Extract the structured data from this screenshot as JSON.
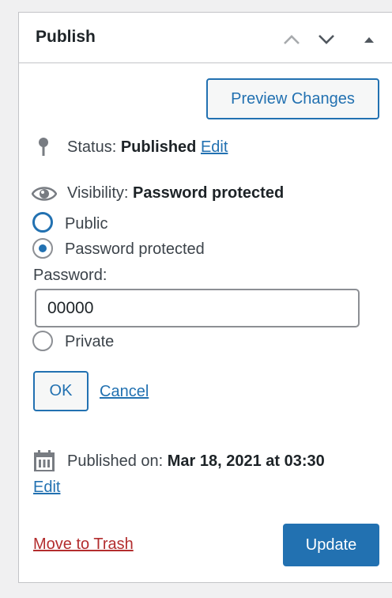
{
  "panel": {
    "title": "Publish",
    "move_up_icon": "chevron-up-icon",
    "move_down_icon": "chevron-down-icon",
    "toggle_icon": "triangle-up-icon"
  },
  "preview_button": "Preview Changes",
  "status": {
    "label": "Status:",
    "value": "Published",
    "edit_link": "Edit",
    "icon": "pin-icon"
  },
  "visibility": {
    "label": "Visibility:",
    "value": "Password protected",
    "icon": "eye-icon",
    "options": [
      {
        "label": "Public",
        "checked": false,
        "focused": true
      },
      {
        "label": "Password protected",
        "checked": true,
        "focused": false
      },
      {
        "label": "Private",
        "checked": false,
        "focused": false
      }
    ],
    "password_label": "Password:",
    "password_value": "00000",
    "ok_button": "OK",
    "cancel_link": "Cancel"
  },
  "published_on": {
    "label": "Published on:",
    "value": "Mar 18, 2021 at 03:30",
    "edit_link": "Edit",
    "icon": "calendar-icon"
  },
  "actions": {
    "trash_link": "Move to Trash",
    "update_button": "Update"
  },
  "colors": {
    "accent": "#2271b1",
    "danger": "#b32d2e",
    "border": "#c3c4c7"
  }
}
